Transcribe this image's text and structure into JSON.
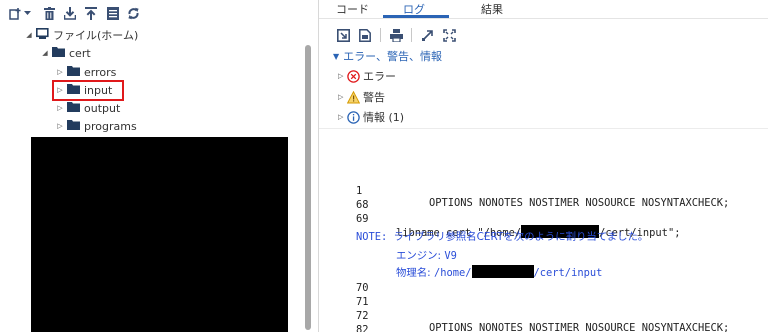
{
  "colors": {
    "accent": "#2b64b5",
    "note_blue": "#2b4ed8",
    "toolbar_icon": "#3a4f73",
    "highlight_red": "#e0191b",
    "folder": "#233c5e"
  },
  "left_toolbar": {
    "icons": [
      "new-item-icon",
      "dropdown-arrow-icon",
      "delete-icon",
      "download-icon",
      "upload-icon",
      "properties-icon",
      "refresh-icon"
    ]
  },
  "tree": {
    "root_label": "ファイル(ホーム)",
    "cert_label": "cert",
    "children": [
      {
        "label": "errors"
      },
      {
        "label": "input"
      },
      {
        "label": "output"
      },
      {
        "label": "programs"
      }
    ]
  },
  "tabs": {
    "code": "コード",
    "log": "ログ",
    "results": "結果",
    "active": "log"
  },
  "log_toolbar": {
    "icons": [
      "save-log-icon",
      "export-log-icon",
      "print-icon",
      "expand-icon",
      "fullscreen-icon"
    ]
  },
  "summary": {
    "header": "エラー、警告、情報",
    "errors_label": "エラー",
    "warnings_label": "警告",
    "info_label": "情報 (1)"
  },
  "log": {
    "line1_num": "1",
    "line1_code": "OPTIONS NONOTES NOSTIMER NOSOURCE NOSYNTAXCHECK;",
    "line68_num": "68",
    "line69_num": "69",
    "line69_pre": "libname cert \"/home/",
    "line69_post": "/cert/input\";",
    "note_prefix": "NOTE: ",
    "note_text": "ライブラリ参照名CERTを次のように割り当てました。",
    "engine_label": "エンジン: ",
    "engine_value": "V9",
    "path_label": "物理名: ",
    "path_pre": "/home/",
    "path_post": "/cert/input",
    "line70_num": "70",
    "line71_num": "71",
    "line72_num": "72",
    "line72_code": "OPTIONS NONOTES NOSTIMER NOSOURCE NOSYNTAXCHECK;",
    "line82_num": "82"
  }
}
